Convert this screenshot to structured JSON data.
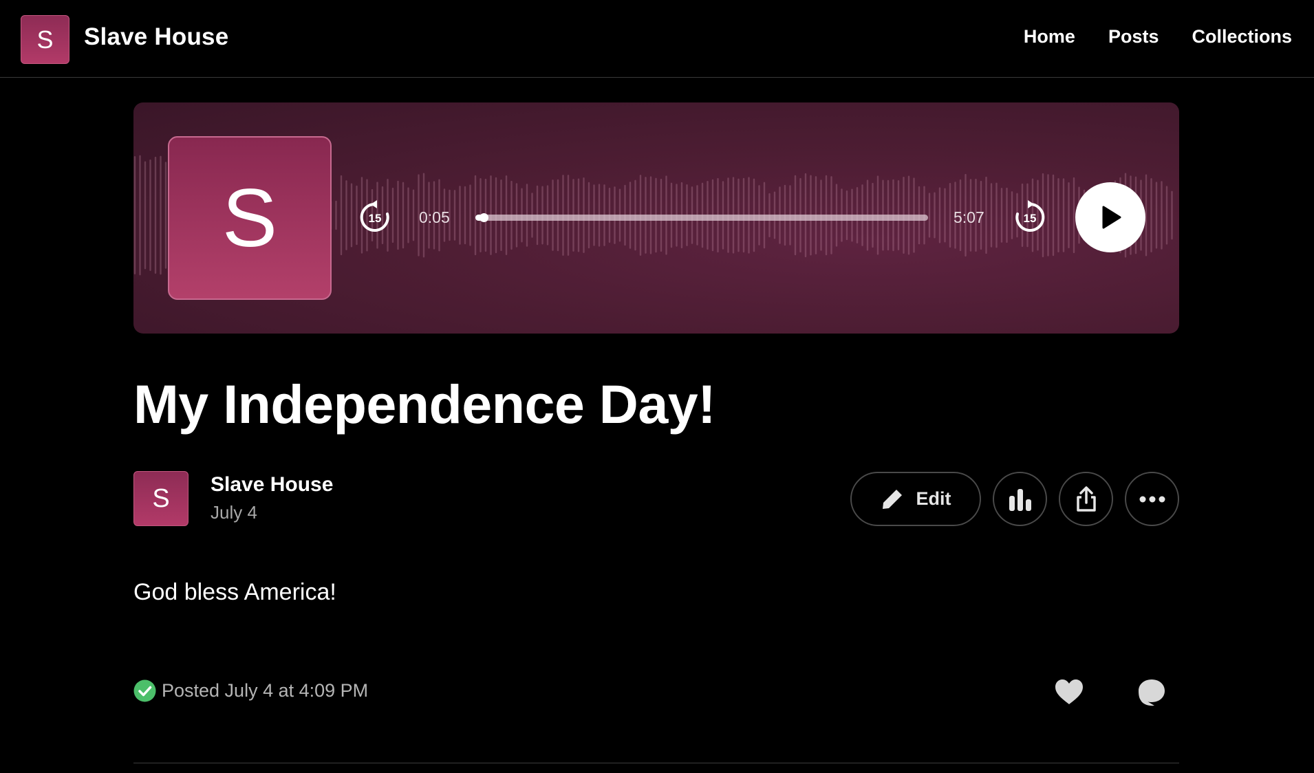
{
  "site": {
    "logo_letter": "S",
    "title": "Slave House"
  },
  "nav": {
    "items": [
      {
        "label": "Home"
      },
      {
        "label": "Posts"
      },
      {
        "label": "Collections"
      }
    ]
  },
  "player": {
    "cover_letter": "S",
    "skip_back_seconds": "15",
    "skip_forward_seconds": "15",
    "current_time": "0:05",
    "total_time": "5:07",
    "progress_fraction": 0.016,
    "icons": {
      "skip_back": "rewind-15-icon",
      "skip_forward": "forward-15-icon",
      "play": "play-icon"
    },
    "colors": {
      "background": "#4d1d33",
      "cover": "#b3406a"
    }
  },
  "post": {
    "title": "My Independence Day!",
    "author": {
      "badge_letter": "S",
      "name": "Slave House",
      "date": "July 4"
    },
    "actions": {
      "edit_label": "Edit",
      "icons": [
        "pencil-icon",
        "bar-chart-icon",
        "share-icon",
        "more-icon"
      ]
    },
    "body": "God bless America!",
    "status": {
      "text": "Posted July 4 at 4:09 PM",
      "icon": "check-circle-icon",
      "color": "#4cbf6a"
    },
    "reactions": {
      "icons": [
        "heart-icon",
        "comment-icon"
      ]
    }
  },
  "colors": {
    "accent": "#b23a68",
    "background": "#000000"
  }
}
